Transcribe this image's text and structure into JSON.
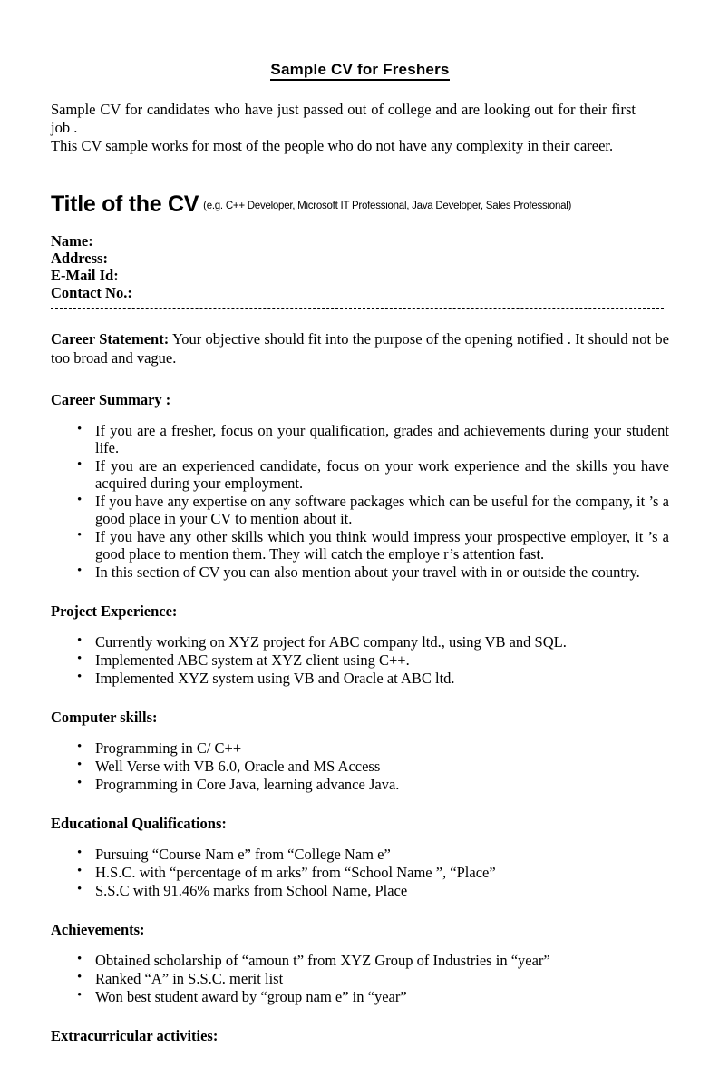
{
  "document": {
    "title": "Sample CV for Freshers",
    "intro_lines": [
      "Sample  CV for candidates who have   just passed out of college and   are looking  out for their first job  .",
      "This CV sample  works for most of the people who do not have any complexity in their career."
    ],
    "cv_title": "Title of the CV",
    "cv_title_note": "(e.g. C++ Developer, Microsoft IT Professional, Java Developer, Sales Professional)",
    "fields": [
      "Name:",
      "Address:",
      "E-Mail Id:",
      "Contact No.:"
    ],
    "career_statement": {
      "label": "Career Statement:",
      "text": " Your  objective   should   fit  into   the  purpose  of the  opening  notified . It should  not  be too broad and vague."
    },
    "sections": [
      {
        "heading": "Career Summary :",
        "items": [
          "If you are  a  fresher,  focus  on your  qualification,  grades  and  achievements  during your  student  life.",
          "If you are an experienced  candidate, focus on your  work experience and  the skills you have acquired during your employment.",
          "If you have any  expertise  on  any  software  packages  which  can  be useful for  the  company,  it    ’s a good place in your CV to mention about it.",
          "If you  have  any  other  skills  which  you  think  would  impress  your  prospective  employer, it    ’s a good place to mention them. They will catch the     employe r’s attention fast.",
          "In this  section of CV you  can also  mention  about your travel  with in  or outside  the country."
        ]
      },
      {
        "heading": "Project Experience:",
        "items": [
          "Currently working on XYZ project for ABC company ltd., using VB and SQL.",
          "Implemented ABC system at XYZ client using C++.",
          "Implemented XYZ system using VB and Oracle at ABC ltd."
        ]
      },
      {
        "heading": "Computer skills:",
        "items": [
          "Programming in C/ C++",
          "Well Verse with VB 6.0, Oracle and MS Access",
          "Programming in Core Java, learning advance Java."
        ]
      },
      {
        "heading": "Educational Qualifications:",
        "items": [
          "Pursuing  “Course Nam e” from “College Nam e”",
          "H.S.C. with “percentage of m arks” from “School Name ”, “Place”",
          "S.S.C with 91.46% marks from School Name, Place"
        ]
      },
      {
        "heading": "Achievements:",
        "items": [
          "Obtained scholarship   of “amoun t” from XYZ Group of Industries in    “year”",
          "Ranked “A” in S.S.C. merit list",
          "Won best student award  by “group nam e” in “year”"
        ]
      },
      {
        "heading": "Extracurricular activities:",
        "items": []
      }
    ]
  }
}
